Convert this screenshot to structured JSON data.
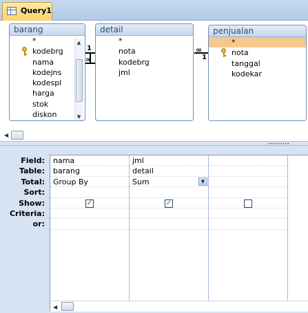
{
  "window": {
    "tab_title": "Query1"
  },
  "tables": [
    {
      "name": "barang",
      "fields": [
        "*",
        "kodebrg",
        "nama",
        "kodejns",
        "kodespl",
        "harga",
        "stok",
        "diskon"
      ],
      "key_field": "kodebrg"
    },
    {
      "name": "detail",
      "fields": [
        "*",
        "nota",
        "kodebrg",
        "jml"
      ]
    },
    {
      "name": "penjualan",
      "fields": [
        "*",
        "nota",
        "tanggal",
        "kodekar"
      ],
      "key_field": "nota",
      "selected_field": "*"
    }
  ],
  "relationships": [
    {
      "from": "barang.kodebrg",
      "to": "detail.kodebrg",
      "one_label": "1",
      "many_label": "∞"
    },
    {
      "from": "penjualan.nota",
      "to": "detail.nota",
      "one_label": "1",
      "many_label": "∞"
    }
  ],
  "grid": {
    "row_labels": [
      "Field:",
      "Table:",
      "Total:",
      "Sort:",
      "Show:",
      "Criteria:",
      "or:"
    ],
    "columns": [
      {
        "field": "nama",
        "table": "barang",
        "total": "Group By",
        "sort": "",
        "show": true,
        "criteria": "",
        "or": ""
      },
      {
        "field": "jml",
        "table": "detail",
        "total": "Sum",
        "sort": "",
        "show": true,
        "criteria": "",
        "or": "",
        "has_dropdown": true
      },
      {
        "field": "",
        "table": "",
        "total": "",
        "sort": "",
        "show": false,
        "criteria": "",
        "or": ""
      }
    ]
  },
  "colors": {
    "accent_tab": "#fbd36a",
    "selected_field": "#f7c88d",
    "grid_background": "#d7e3f3",
    "checkmark": "#1f7a1f"
  }
}
